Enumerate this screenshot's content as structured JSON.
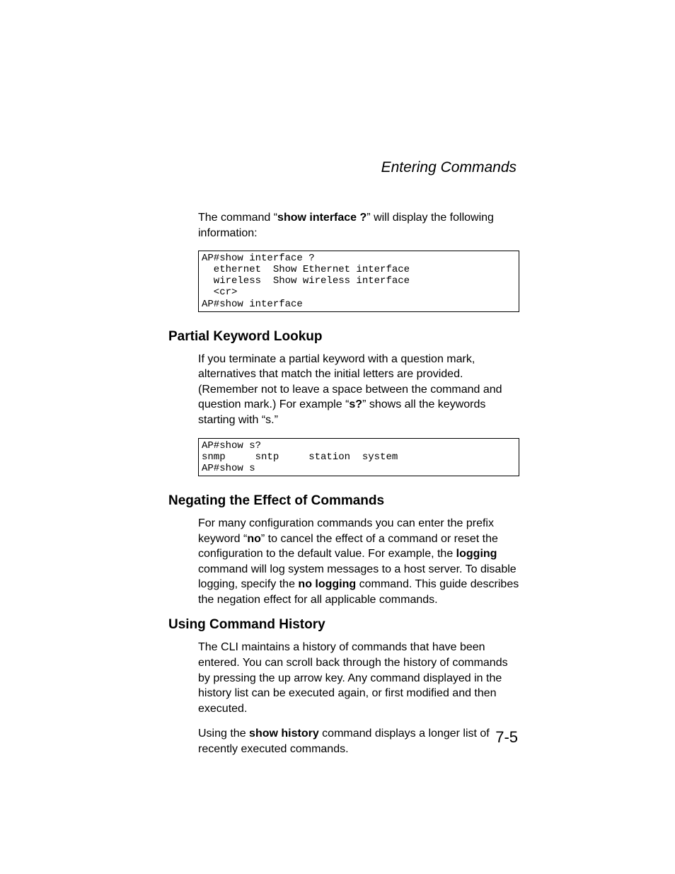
{
  "header": {
    "title": "Entering Commands"
  },
  "intro": {
    "text_before": "The command “",
    "bold": "show interface ?",
    "text_after": "” will display the following information:"
  },
  "code1": "AP#show interface ?\n  ethernet  Show Ethernet interface\n  wireless  Show wireless interface\n  <cr>\nAP#show interface",
  "section1": {
    "heading": "Partial Keyword Lookup",
    "p1_before": "If you terminate a partial keyword with a question mark, alternatives that match the initial letters are provided. (Remember not to leave a space between the command and question mark.) For example “",
    "p1_bold": "s?",
    "p1_after": "” shows all the keywords starting with “s.”"
  },
  "code2": "AP#show s?\nsnmp     sntp     station  system\nAP#show s",
  "section2": {
    "heading": "Negating the Effect of Commands",
    "p1_a": "For many configuration commands you can enter the prefix keyword “",
    "p1_b1": "no",
    "p1_b": "” to cancel the effect of a command or reset the configuration to the default value. For example, the ",
    "p1_b2": "logging",
    "p1_c": " command will log system messages to a host server. To disable logging, specify the ",
    "p1_b3": "no logging",
    "p1_d": " command. This guide describes the negation effect for all applicable commands."
  },
  "section3": {
    "heading": "Using Command History",
    "p1": "The CLI maintains a history of commands that have been entered. You can scroll back through the history of commands by pressing the up arrow key. Any command displayed in the history list can be executed again, or first modified and then executed.",
    "p2_a": "Using the ",
    "p2_b": "show history",
    "p2_c": " command displays a longer list of recently executed commands."
  },
  "page_number": "7-5"
}
